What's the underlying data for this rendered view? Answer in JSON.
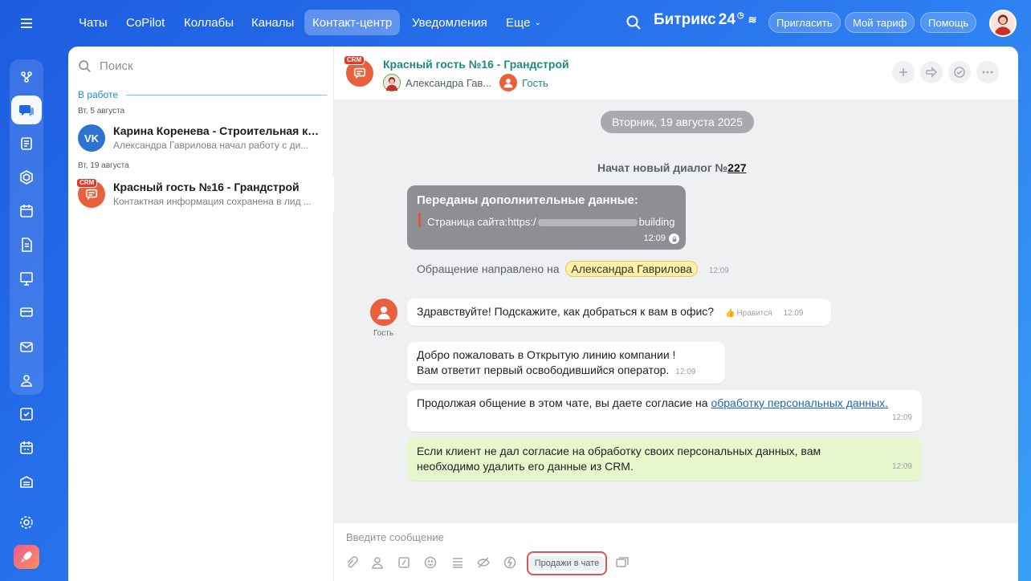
{
  "topnav": {
    "items": [
      "Чаты",
      "CoPilot",
      "Коллабы",
      "Каналы",
      "Контакт-центр",
      "Уведомления",
      "Еще"
    ],
    "active": "Контакт-центр",
    "brand": "Битрикс",
    "brand_num": "24",
    "invite": "Пригласить",
    "tariff": "Мой тариф",
    "help": "Помощь"
  },
  "left": {
    "search_placeholder": "Поиск",
    "group_label": "В работе",
    "dates": [
      "Вт, 5 августа",
      "Вт, 19 августа"
    ],
    "chats": [
      {
        "title": "Карина Коренева - Строительная ко...",
        "subtitle": "Александра Гаврилова начал работу с ди...",
        "avatar": "VK"
      },
      {
        "title": "Красный гость №16 - Грандстрой",
        "subtitle": "Контактная информация сохранена в лид ...",
        "avatar": "CRM"
      }
    ]
  },
  "chat": {
    "title": "Красный гость №16 - Грандстрой",
    "crm_tag": "CRM",
    "operator": "Александра Гав...",
    "guest": "Гость",
    "date_pill": "Вторник, 19 августа 2025",
    "started": "Начат новый диалог №",
    "dialog_no": "227",
    "extra": {
      "title": "Переданы дополнительные данные:",
      "label": "Страница сайта:",
      "url_start": "https:/",
      "url_end": "building",
      "time": "12:09"
    },
    "routed": "Обращение направлено на",
    "routed_to": "Александра Гаврилова",
    "routed_time": "12:09",
    "guest_label": "Гость",
    "guest_msg": {
      "text": "Здравствуйте! Подскажите, как добраться к вам в офис?",
      "like": "Нравится",
      "time": "12:09"
    },
    "welcome": {
      "line1": "Добро пожаловать в Открытую линию компании !",
      "line2": "Вам ответит первый освободившийся оператор.",
      "time": "12:09"
    },
    "consent": {
      "text": "Продолжая общение в этом чате, вы даете согласие на ",
      "link": "обработку персональных данных.",
      "time": "12:09"
    },
    "note": {
      "text": "Если клиент не дал согласие на обработку своих персональных данных, вам необходимо удалить его данные из CRM.",
      "time": "12:09"
    },
    "input_placeholder": "Введите сообщение",
    "sales_button": "Продажи в чате"
  },
  "colors": {
    "accent": "#2066e0",
    "crm": "#e53a2a",
    "note_bg": "#e8f6cd",
    "highlight": "#fff1a8"
  }
}
